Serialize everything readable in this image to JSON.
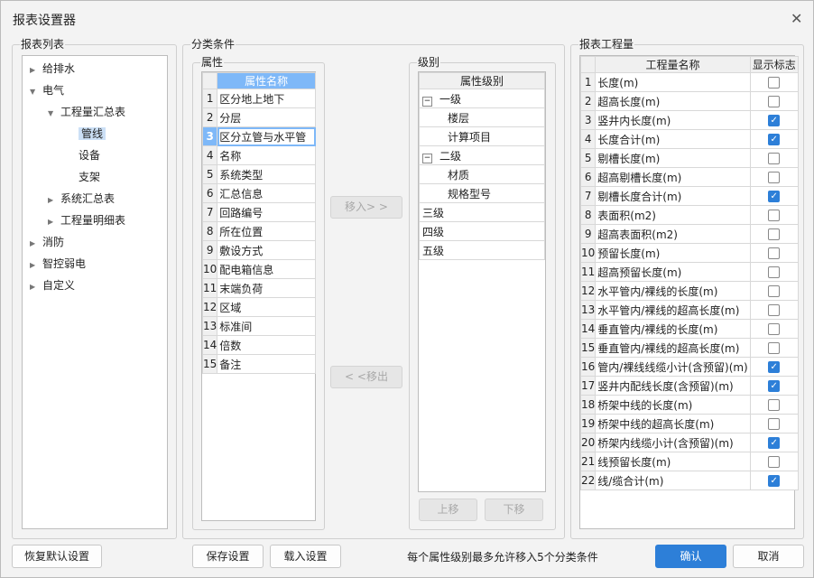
{
  "window": {
    "title": "报表设置器"
  },
  "report_list": {
    "legend": "报表列表",
    "items": [
      {
        "label": "给排水",
        "level": 0,
        "state": "collapsed"
      },
      {
        "label": "电气",
        "level": 0,
        "state": "expanded"
      },
      {
        "label": "工程量汇总表",
        "level": 1,
        "state": "expanded"
      },
      {
        "label": "管线",
        "level": 2,
        "state": "leaf",
        "selected": true
      },
      {
        "label": "设备",
        "level": 2,
        "state": "leaf"
      },
      {
        "label": "支架",
        "level": 2,
        "state": "leaf"
      },
      {
        "label": "系统汇总表",
        "level": 1,
        "state": "collapsed"
      },
      {
        "label": "工程量明细表",
        "level": 1,
        "state": "collapsed"
      },
      {
        "label": "消防",
        "level": 0,
        "state": "collapsed"
      },
      {
        "label": "智控弱电",
        "level": 0,
        "state": "collapsed"
      },
      {
        "label": "自定义",
        "level": 0,
        "state": "collapsed"
      }
    ]
  },
  "classification": {
    "legend": "分类条件",
    "attributes": {
      "legend": "属性",
      "header": "属性名称",
      "selected_row": 3,
      "header_color": "#7eb8f8",
      "rows": [
        "区分地上地下",
        "分层",
        "区分立管与水平管",
        "名称",
        "系统类型",
        "汇总信息",
        "回路编号",
        "所在位置",
        "敷设方式",
        "配电箱信息",
        "末端负荷",
        "区域",
        "标准间",
        "倍数",
        "备注"
      ]
    },
    "move_in_label": "移入> >",
    "move_out_label": "< <移出",
    "levels": {
      "legend": "级别",
      "header": "属性级别",
      "rows": [
        {
          "label": "一级",
          "type": "group"
        },
        {
          "label": "楼层",
          "type": "child"
        },
        {
          "label": "计算项目",
          "type": "child"
        },
        {
          "label": "二级",
          "type": "group"
        },
        {
          "label": "材质",
          "type": "child"
        },
        {
          "label": "规格型号",
          "type": "child"
        },
        {
          "label": "三级",
          "type": "plain"
        },
        {
          "label": "四级",
          "type": "plain"
        },
        {
          "label": "五级",
          "type": "plain"
        }
      ]
    },
    "up_label": "上移",
    "down_label": "下移"
  },
  "quantities": {
    "legend": "报表工程量",
    "col_name": "工程量名称",
    "col_show": "显示标志",
    "rows": [
      {
        "name": "长度(m)",
        "show": false
      },
      {
        "name": "超高长度(m)",
        "show": false
      },
      {
        "name": "竖井内长度(m)",
        "show": true
      },
      {
        "name": "长度合计(m)",
        "show": true
      },
      {
        "name": "剔槽长度(m)",
        "show": false
      },
      {
        "name": "超高剔槽长度(m)",
        "show": false
      },
      {
        "name": "剔槽长度合计(m)",
        "show": true
      },
      {
        "name": "表面积(m2)",
        "show": false
      },
      {
        "name": "超高表面积(m2)",
        "show": false
      },
      {
        "name": "预留长度(m)",
        "show": false
      },
      {
        "name": "超高预留长度(m)",
        "show": false
      },
      {
        "name": "水平管内/裸线的长度(m)",
        "show": false
      },
      {
        "name": "水平管内/裸线的超高长度(m)",
        "show": false
      },
      {
        "name": "垂直管内/裸线的长度(m)",
        "show": false
      },
      {
        "name": "垂直管内/裸线的超高长度(m)",
        "show": false
      },
      {
        "name": "管内/裸线线缆小计(含预留)(m)",
        "show": true
      },
      {
        "name": "竖井内配线长度(含预留)(m)",
        "show": true
      },
      {
        "name": "桥架中线的长度(m)",
        "show": false
      },
      {
        "name": "桥架中线的超高长度(m)",
        "show": false
      },
      {
        "name": "桥架内线缆小计(含预留)(m)",
        "show": true
      },
      {
        "name": "线预留长度(m)",
        "show": false
      },
      {
        "name": "线/缆合计(m)",
        "show": true
      }
    ]
  },
  "footer": {
    "restore_label": "恢复默认设置",
    "save_label": "保存设置",
    "load_label": "载入设置",
    "hint": "每个属性级别最多允许移入5个分类条件",
    "ok_label": "确认",
    "cancel_label": "取消"
  },
  "colors": {
    "accent": "#2d7fd8",
    "selection": "#cce0f6"
  }
}
